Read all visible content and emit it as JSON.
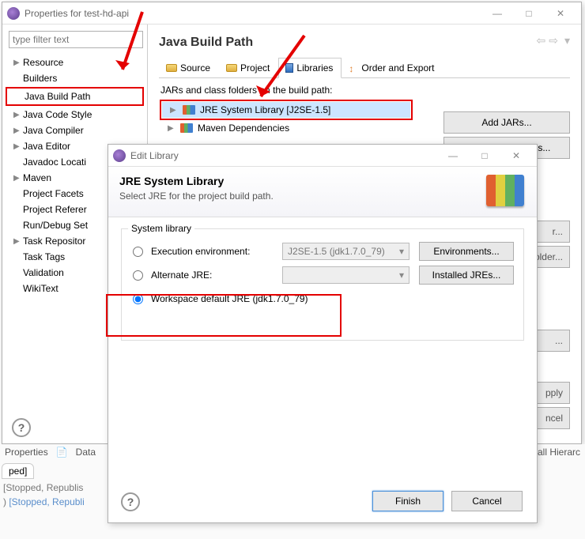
{
  "window": {
    "title": "Properties for test-hd-api"
  },
  "filter": {
    "placeholder": "type filter text"
  },
  "tree": [
    {
      "label": "Resource",
      "expand": true
    },
    {
      "label": "Builders",
      "expand": false
    },
    {
      "label": "Java Build Path",
      "expand": false,
      "hl": true
    },
    {
      "label": "Java Code Style",
      "expand": true
    },
    {
      "label": "Java Compiler",
      "expand": true
    },
    {
      "label": "Java Editor",
      "expand": true
    },
    {
      "label": "Javadoc Location",
      "expand": false,
      "trunc": "Javadoc Locati"
    },
    {
      "label": "Maven",
      "expand": true
    },
    {
      "label": "Project Facets",
      "expand": false,
      "trunc": "Project Facets"
    },
    {
      "label": "Project References",
      "expand": false,
      "trunc": "Project Referer"
    },
    {
      "label": "Run/Debug Settings",
      "expand": false,
      "trunc": "Run/Debug Set"
    },
    {
      "label": "Task Repository",
      "expand": true,
      "trunc": "Task Repositor"
    },
    {
      "label": "Task Tags",
      "expand": false
    },
    {
      "label": "Validation",
      "expand": false
    },
    {
      "label": "WikiText",
      "expand": false
    }
  ],
  "main": {
    "heading": "Java Build Path",
    "tabs": [
      {
        "label": "Source"
      },
      {
        "label": "Project"
      },
      {
        "label": "Libraries",
        "active": true
      },
      {
        "label": "Order and Export"
      }
    ],
    "buildlabel": "JARs and class folders on the build path:",
    "rows": [
      {
        "label": "JRE System Library [J2SE-1.5]",
        "sel": true
      },
      {
        "label": "Maven Dependencies",
        "sel": false
      }
    ],
    "buttons": {
      "add_jars": "Add JARs...",
      "add_ext": "Add External JARs...",
      "r_trail": "r...",
      "older_trail": "older...",
      "dots": "...",
      "pply": "pply",
      "ncel": "ncel"
    }
  },
  "dlg": {
    "title": "Edit Library",
    "heading": "JRE System Library",
    "sub": "Select JRE for the project build path.",
    "group": "System library",
    "opt1": "Execution environment:",
    "opt1val": "J2SE-1.5 (jdk1.7.0_79)",
    "btn1": "Environments...",
    "opt2": "Alternate JRE:",
    "btn2": "Installed JREs...",
    "opt3": "Workspace default JRE (jdk1.7.0_79)",
    "finish": "Finish",
    "cancel": "Cancel"
  },
  "strip": {
    "tabs": [
      "Properties",
      "Data"
    ],
    "right": "all Hierarc",
    "pill": "ped]",
    "line1_a": "  [Stopped, Republis",
    "line2_a": ")  ",
    "line2_b": "[Stopped, Republi"
  }
}
